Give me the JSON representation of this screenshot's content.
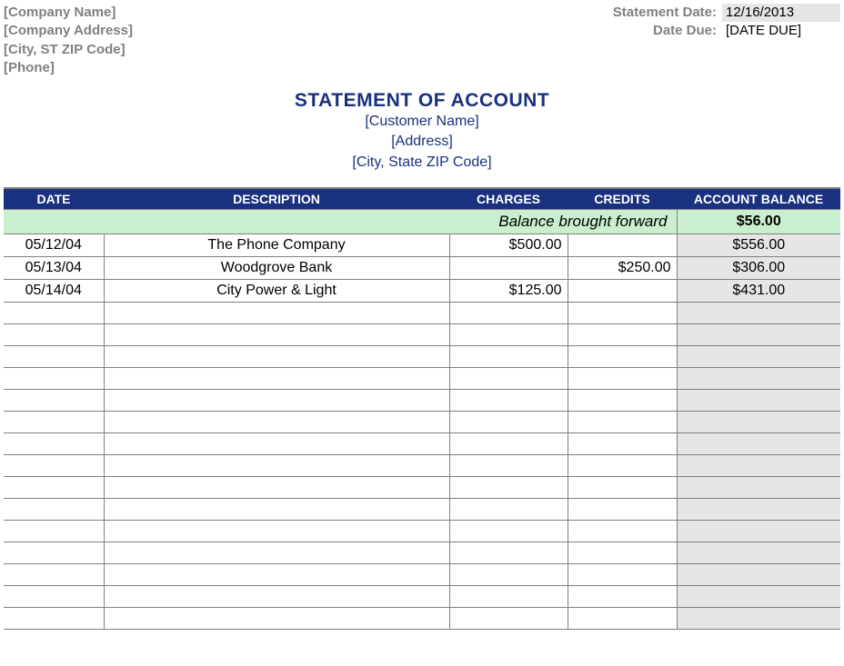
{
  "company": {
    "name": "[Company Name]",
    "address": "[Company Address]",
    "city_st_zip": "[City, ST  ZIP Code]",
    "phone": "[Phone]"
  },
  "meta": {
    "statement_date_label": "Statement Date:",
    "statement_date_value": "12/16/2013",
    "date_due_label": "Date Due:",
    "date_due_value": "[DATE DUE]"
  },
  "title": {
    "main": "STATEMENT OF ACCOUNT",
    "customer_name": "[Customer Name]",
    "address": "[Address]",
    "city_state_zip": "[City, State  ZIP Code]"
  },
  "columns": {
    "date": "DATE",
    "description": "DESCRIPTION",
    "charges": "CHARGES",
    "credits": "CREDITS",
    "balance": "ACCOUNT BALANCE"
  },
  "balance_forward": {
    "label": "Balance brought forward",
    "amount": "$56.00"
  },
  "rows": [
    {
      "date": "05/12/04",
      "description": "The Phone Company",
      "charges": "$500.00",
      "credits": "",
      "balance": "$556.00"
    },
    {
      "date": "05/13/04",
      "description": "Woodgrove Bank",
      "charges": "",
      "credits": "$250.00",
      "balance": "$306.00"
    },
    {
      "date": "05/14/04",
      "description": "City Power & Light",
      "charges": "$125.00",
      "credits": "",
      "balance": "$431.00"
    },
    {
      "date": "",
      "description": "",
      "charges": "",
      "credits": "",
      "balance": ""
    },
    {
      "date": "",
      "description": "",
      "charges": "",
      "credits": "",
      "balance": ""
    },
    {
      "date": "",
      "description": "",
      "charges": "",
      "credits": "",
      "balance": ""
    },
    {
      "date": "",
      "description": "",
      "charges": "",
      "credits": "",
      "balance": ""
    },
    {
      "date": "",
      "description": "",
      "charges": "",
      "credits": "",
      "balance": ""
    },
    {
      "date": "",
      "description": "",
      "charges": "",
      "credits": "",
      "balance": ""
    },
    {
      "date": "",
      "description": "",
      "charges": "",
      "credits": "",
      "balance": ""
    },
    {
      "date": "",
      "description": "",
      "charges": "",
      "credits": "",
      "balance": ""
    },
    {
      "date": "",
      "description": "",
      "charges": "",
      "credits": "",
      "balance": ""
    },
    {
      "date": "",
      "description": "",
      "charges": "",
      "credits": "",
      "balance": ""
    },
    {
      "date": "",
      "description": "",
      "charges": "",
      "credits": "",
      "balance": ""
    },
    {
      "date": "",
      "description": "",
      "charges": "",
      "credits": "",
      "balance": ""
    },
    {
      "date": "",
      "description": "",
      "charges": "",
      "credits": "",
      "balance": ""
    },
    {
      "date": "",
      "description": "",
      "charges": "",
      "credits": "",
      "balance": ""
    },
    {
      "date": "",
      "description": "",
      "charges": "",
      "credits": "",
      "balance": ""
    }
  ]
}
